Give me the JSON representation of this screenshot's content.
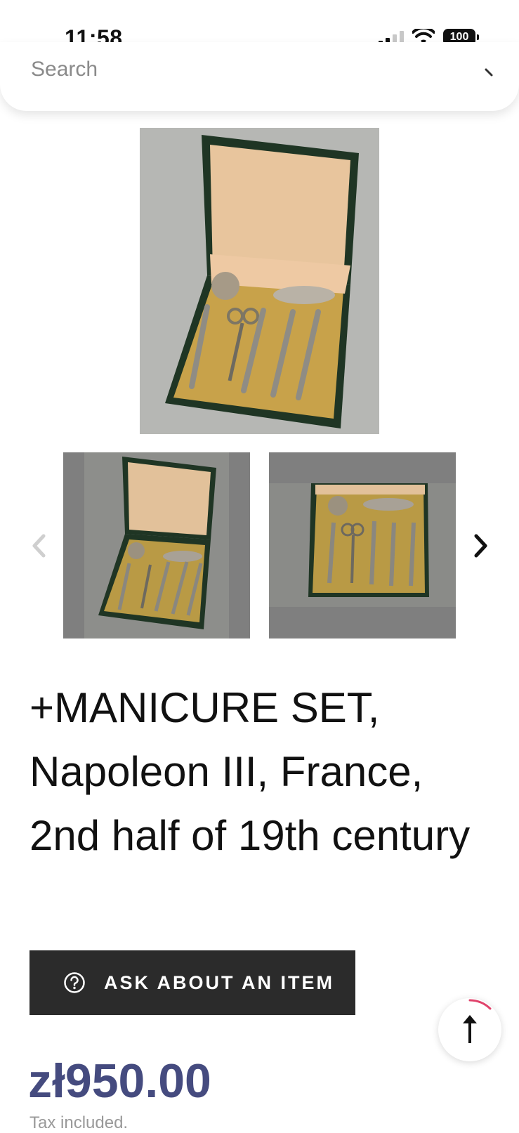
{
  "status_bar": {
    "time": "11:58",
    "battery": "100"
  },
  "search": {
    "placeholder": "Search",
    "icon": "search-icon"
  },
  "gallery": {
    "main_image": "manicure-set-open-case",
    "thumbnails": [
      "manicure-set-open-case",
      "manicure-set-close-up"
    ],
    "prev_icon": "chevron-left-icon",
    "next_icon": "chevron-right-icon"
  },
  "product": {
    "title": "+MANICURE SET, Napoleon III, France, 2nd half of 19th century",
    "ask_button_label": "ASK ABOUT AN ITEM",
    "ask_button_icon": "question-circle-icon",
    "price": "zł950.00",
    "tax_note": "Tax included."
  },
  "scroll_top": {
    "icon": "arrow-up-icon"
  },
  "colors": {
    "price": "#454b7f",
    "button_bg": "#2b2b2b",
    "scroll_progress": "#e0436b"
  }
}
